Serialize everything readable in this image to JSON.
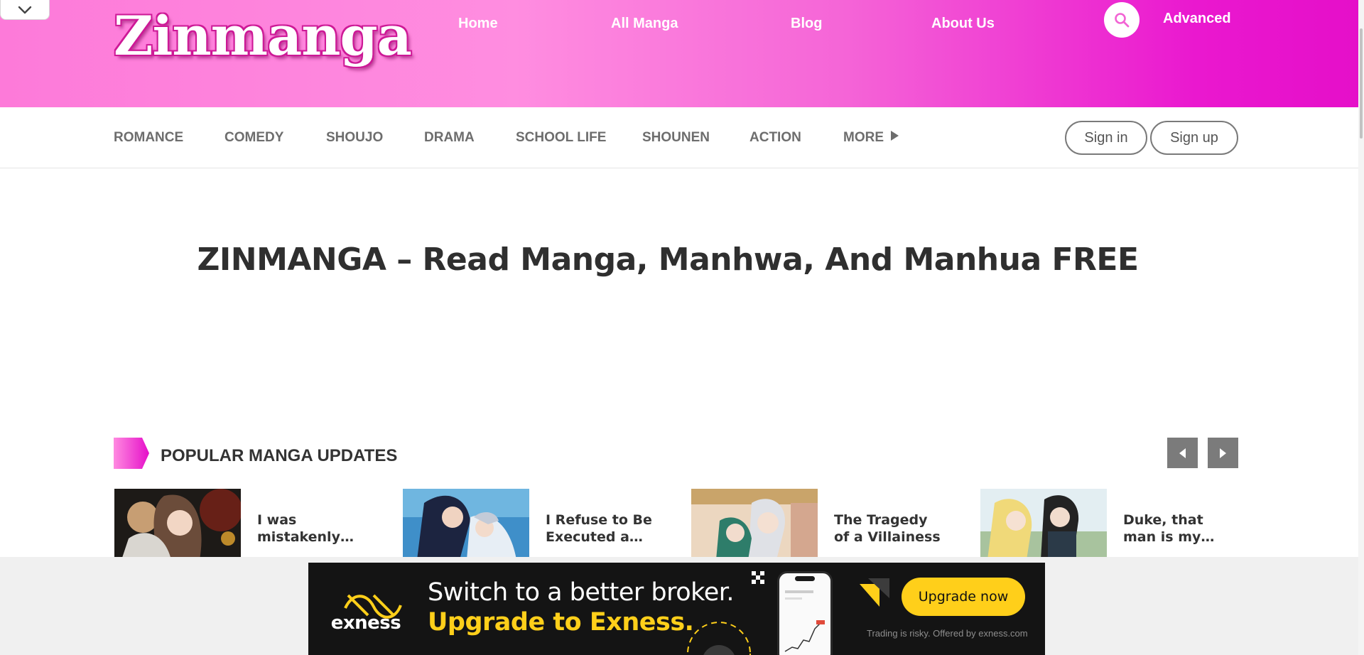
{
  "header": {
    "logo": "Zinmanga",
    "nav": [
      {
        "label": "Home"
      },
      {
        "label": "All Manga"
      },
      {
        "label": "Blog"
      },
      {
        "label": "About Us"
      }
    ],
    "search_icon": "search-icon",
    "advanced_label": "Advanced",
    "colors": {
      "gradient_start": "#fd7ad9",
      "gradient_end": "#e50fc9"
    }
  },
  "genres": [
    {
      "label": "ROMANCE"
    },
    {
      "label": "COMEDY"
    },
    {
      "label": "SHOUJO"
    },
    {
      "label": "DRAMA"
    },
    {
      "label": "SCHOOL LIFE"
    },
    {
      "label": "SHOUNEN"
    },
    {
      "label": "ACTION"
    },
    {
      "label": "MORE"
    }
  ],
  "auth": {
    "signin_label": "Sign in",
    "signup_label": "Sign up"
  },
  "hero": {
    "title": "ZINMANGA – Read Manga, Manhwa, And Manhua FREE"
  },
  "popular": {
    "heading": "POPULAR MANGA UPDATES",
    "items": [
      {
        "title": "I was mistakenly…"
      },
      {
        "title": "I Refuse to Be Executed a…"
      },
      {
        "title": "The Tragedy of a Villainess"
      },
      {
        "title": "Duke, that man is my…"
      }
    ]
  },
  "ad": {
    "brand": "exness",
    "headline": "Switch to a better broker.",
    "subheadline": "Upgrade to Exness.",
    "cta": "Upgrade now",
    "disclaimer": "Trading is risky. Offered by exness.com",
    "accent_color": "#ffcf1a"
  }
}
